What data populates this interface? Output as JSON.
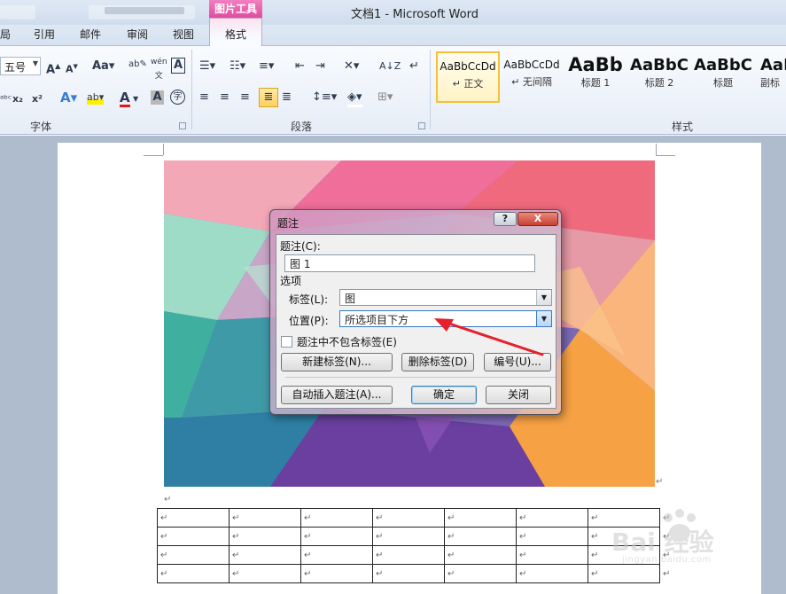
{
  "window": {
    "title": "文档1  -  Microsoft Word",
    "context_group": "图片工具"
  },
  "tabs": [
    {
      "label": "局",
      "active": false
    },
    {
      "label": "引用",
      "active": false
    },
    {
      "label": "邮件",
      "active": false
    },
    {
      "label": "审阅",
      "active": false
    },
    {
      "label": "视图",
      "active": false
    },
    {
      "label": "格式",
      "active": true
    }
  ],
  "ribbon": {
    "font_group_label": "字体",
    "paragraph_group_label": "段落",
    "styles_group_label": "样式",
    "font_size_value": "五号",
    "styles": [
      {
        "sample": "AaBbCcDd",
        "name": "↵ 正文",
        "active": true
      },
      {
        "sample": "AaBbCcDd",
        "name": "↵ 无间隔",
        "active": false
      },
      {
        "sample": "AaBb",
        "name": "标题 1",
        "active": false
      },
      {
        "sample": "AaBbC",
        "name": "标题 2",
        "active": false
      },
      {
        "sample": "AaBbC",
        "name": "标题",
        "active": false
      },
      {
        "sample": "AaB",
        "name": "副标",
        "active": false
      }
    ]
  },
  "dialog": {
    "title": "题注",
    "help_glyph": "?",
    "close_glyph": "X",
    "caption_label": "题注(C):",
    "caption_value": "图  1",
    "options_label": "选项",
    "label_label": "标签(L):",
    "label_value": "图",
    "position_label": "位置(P):",
    "position_value": "所选项目下方",
    "exclude_label_text": "题注中不包含标签(E)",
    "exclude_label_checked": false,
    "new_label_button": "新建标签(N)...",
    "delete_label_button": "删除标签(D)",
    "numbering_button": "编号(U)...",
    "autocaption_button": "自动插入题注(A)...",
    "ok_button": "确定",
    "close_button": "关闭"
  },
  "document": {
    "paragraph_mark": "↵",
    "table": {
      "rows": 4,
      "cols": 7
    }
  },
  "watermark": {
    "text": "Bai  经验",
    "subtext": "jingyan.baidu.com"
  }
}
